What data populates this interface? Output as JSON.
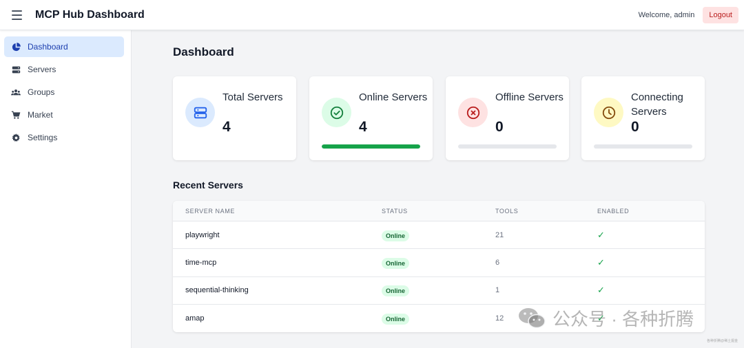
{
  "header": {
    "title": "MCP Hub Dashboard",
    "welcome": "Welcome, admin",
    "logout_label": "Logout"
  },
  "sidebar": {
    "items": [
      {
        "label": "Dashboard",
        "icon": "pie-chart-icon",
        "active": true
      },
      {
        "label": "Servers",
        "icon": "server-icon"
      },
      {
        "label": "Groups",
        "icon": "users-icon"
      },
      {
        "label": "Market",
        "icon": "cart-icon"
      },
      {
        "label": "Settings",
        "icon": "gear-icon"
      }
    ]
  },
  "main": {
    "title": "Dashboard",
    "stats": [
      {
        "label": "Total Servers",
        "value": "4",
        "icon": "server-icon",
        "color": "#2563eb",
        "bg": "#dbeafe"
      },
      {
        "label": "Online Servers",
        "value": "4",
        "icon": "check-circle-icon",
        "color": "#15803d",
        "bg": "#dcfce7",
        "progress": 1.0
      },
      {
        "label": "Offline Servers",
        "value": "0",
        "icon": "x-circle-icon",
        "color": "#b91c1c",
        "bg": "#fee2e2",
        "progress": 0.0
      },
      {
        "label": "Connecting Servers",
        "value": "0",
        "icon": "clock-icon",
        "color": "#854d0e",
        "bg": "#fef9c3",
        "progress": 0.0
      }
    ],
    "recent_title": "Recent Servers",
    "table": {
      "columns": [
        "SERVER NAME",
        "STATUS",
        "TOOLS",
        "ENABLED"
      ],
      "rows": [
        {
          "name": "playwright",
          "status": "Online",
          "tools": "21",
          "enabled": "✓"
        },
        {
          "name": "time-mcp",
          "status": "Online",
          "tools": "6",
          "enabled": "✓"
        },
        {
          "name": "sequential-thinking",
          "status": "Online",
          "tools": "1",
          "enabled": "✓"
        },
        {
          "name": "amap",
          "status": "Online",
          "tools": "12",
          "enabled": "✓"
        }
      ]
    }
  },
  "watermark": {
    "text": "公众号 · 各种折腾",
    "small": "各种折腾@稀土掘金"
  },
  "colors": {
    "accent": "#2563eb",
    "online": "#16a34a"
  }
}
